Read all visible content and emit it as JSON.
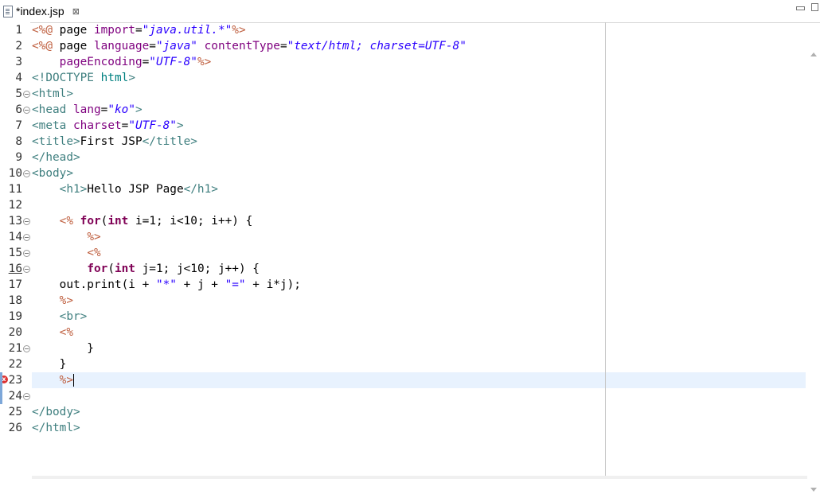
{
  "tab": {
    "title": "*index.jsp",
    "close_symbol": "⊠",
    "icon": "file-icon"
  },
  "window": {
    "minimize_icon": "minimize-icon",
    "maximize_icon": "maximize-icon"
  },
  "editor": {
    "error_symbol": "x",
    "lines": [
      {
        "n": "1"
      },
      {
        "n": "2"
      },
      {
        "n": "3"
      },
      {
        "n": "4"
      },
      {
        "n": "5"
      },
      {
        "n": "6"
      },
      {
        "n": "7"
      },
      {
        "n": "8"
      },
      {
        "n": "9"
      },
      {
        "n": "10"
      },
      {
        "n": "11"
      },
      {
        "n": "12"
      },
      {
        "n": "13"
      },
      {
        "n": "14"
      },
      {
        "n": "15"
      },
      {
        "n": "16"
      },
      {
        "n": "17"
      },
      {
        "n": "18"
      },
      {
        "n": "19"
      },
      {
        "n": "20"
      },
      {
        "n": "21"
      },
      {
        "n": "22"
      },
      {
        "n": "23"
      },
      {
        "n": "24"
      },
      {
        "n": "25"
      },
      {
        "n": "26"
      }
    ],
    "code": {
      "l1": [
        "<%@",
        " page ",
        "import",
        "=",
        "\"java.util.*\"",
        "%>"
      ],
      "l2": [
        "<%@",
        " page ",
        "language",
        "=",
        "\"java\"",
        " ",
        "contentType",
        "=",
        "\"text/html; charset=UTF-8\""
      ],
      "l3": [
        "    ",
        "pageEncoding",
        "=",
        "\"UTF-8\"",
        "%>"
      ],
      "l4": [
        "<!DOCTYPE",
        " html",
        ">"
      ],
      "l5": [
        "<html>"
      ],
      "l6": [
        "<head",
        " ",
        "lang",
        "=",
        "\"ko\"",
        ">"
      ],
      "l7": [
        "<meta",
        " ",
        "charset",
        "=",
        "\"UTF-8\"",
        ">"
      ],
      "l8": [
        "<title>",
        "First JSP",
        "</title>"
      ],
      "l9": [
        "</head>"
      ],
      "l10": [
        "<body>"
      ],
      "l11": [
        "    ",
        "<h1>",
        "Hello JSP Page",
        "</h1>"
      ],
      "l13": [
        "    ",
        "<%",
        " ",
        "for",
        "(",
        "int",
        " i=1; i<10; i++) {"
      ],
      "l14": [
        "        ",
        "%>"
      ],
      "l15": [
        "        ",
        "<%"
      ],
      "l16": [
        "        ",
        "for",
        "(",
        "int",
        " j=1; j<10; j++) {"
      ],
      "l17": [
        "    out.print(i + ",
        "\"*\"",
        " + j + ",
        "\"=\"",
        " + i*j);"
      ],
      "l18": [
        "    ",
        "%>"
      ],
      "l19": [
        "    ",
        "<br>"
      ],
      "l20": [
        "    ",
        "<%"
      ],
      "l21": [
        "        }"
      ],
      "l22": [
        "    }"
      ],
      "l23": [
        "    ",
        "%>"
      ],
      "l25": [
        "</body>"
      ],
      "l26": [
        "</html>"
      ]
    }
  },
  "colors": {
    "tag": "#3f7f7f",
    "attr": "#7f007f",
    "string": "#2a00ff",
    "delimiter": "#bf5f3f",
    "keyword": "#7f0055",
    "current_line": "#e8f2fe"
  }
}
